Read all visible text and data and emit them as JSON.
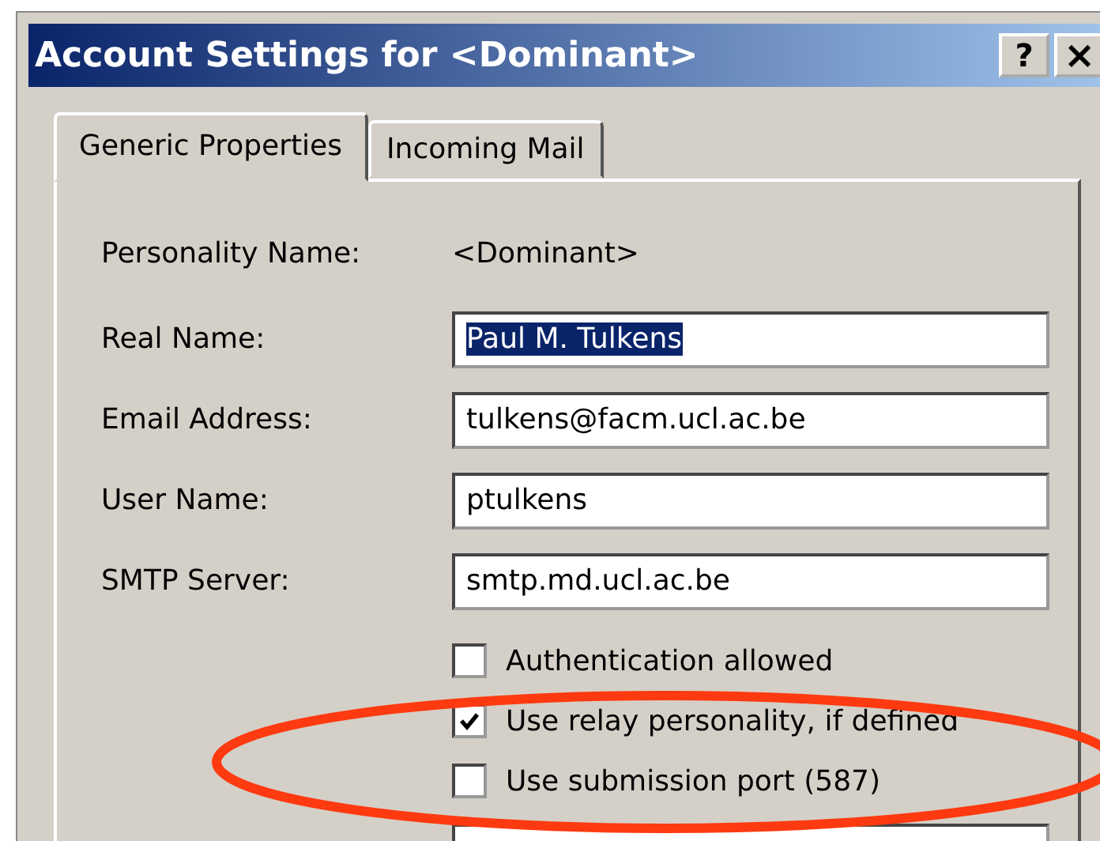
{
  "window": {
    "title": "Account Settings for <Dominant>",
    "buttons": [
      {
        "kind": "help",
        "label": "?"
      },
      {
        "kind": "close",
        "label": "×"
      }
    ]
  },
  "tabs": [
    {
      "label": "Generic Properties",
      "selected": true
    },
    {
      "label": "Incoming Mail",
      "selected": false
    }
  ],
  "personality": {
    "label": "Personality Name:",
    "value": "<Dominant>"
  },
  "fields": [
    {
      "label": "Real Name:",
      "value": "Paul M. Tulkens",
      "text_selected": true
    },
    {
      "label": "Email Address:",
      "value": "tulkens@facm.ucl.ac.be",
      "text_selected": false
    },
    {
      "label": "User Name:",
      "value": "ptulkens",
      "text_selected": false
    },
    {
      "label": "SMTP Server:",
      "value": "smtp.md.ucl.ac.be",
      "text_selected": false
    }
  ],
  "checkboxes": [
    {
      "label": "Authentication allowed",
      "checked": false
    },
    {
      "label": "Use relay personality, if defined",
      "checked": true
    },
    {
      "label": "Use submission port (587)",
      "checked": false
    }
  ]
}
